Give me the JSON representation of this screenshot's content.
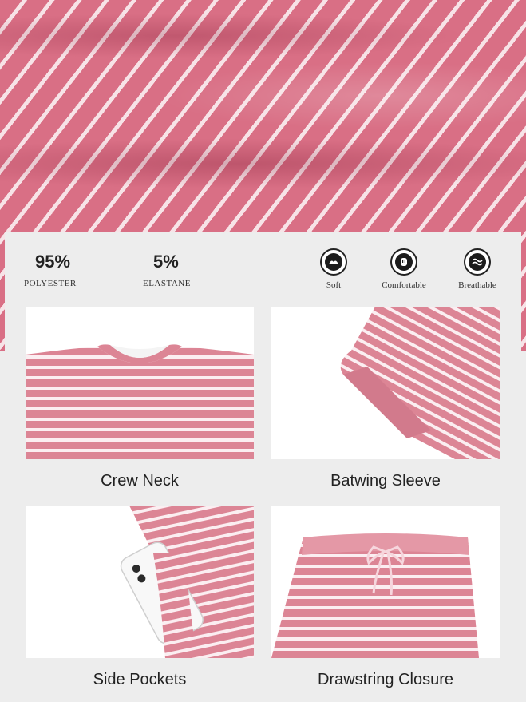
{
  "material": {
    "primary_percent": "95%",
    "primary_name": "POLYESTER",
    "secondary_percent": "5%",
    "secondary_name": "ELASTANE"
  },
  "features": [
    {
      "label": "Soft",
      "icon": "soft-icon"
    },
    {
      "label": "Comfortable",
      "icon": "comfortable-icon"
    },
    {
      "label": "Breathable",
      "icon": "breathable-icon"
    }
  ],
  "details": [
    {
      "caption": "Crew Neck"
    },
    {
      "caption": "Batwing Sleeve"
    },
    {
      "caption": "Side Pockets"
    },
    {
      "caption": "Drawstring Closure"
    }
  ],
  "colors": {
    "fabric_pink": "#d96f85",
    "stripe_white": "#f7e3e7",
    "panel_bg": "#ededed"
  }
}
